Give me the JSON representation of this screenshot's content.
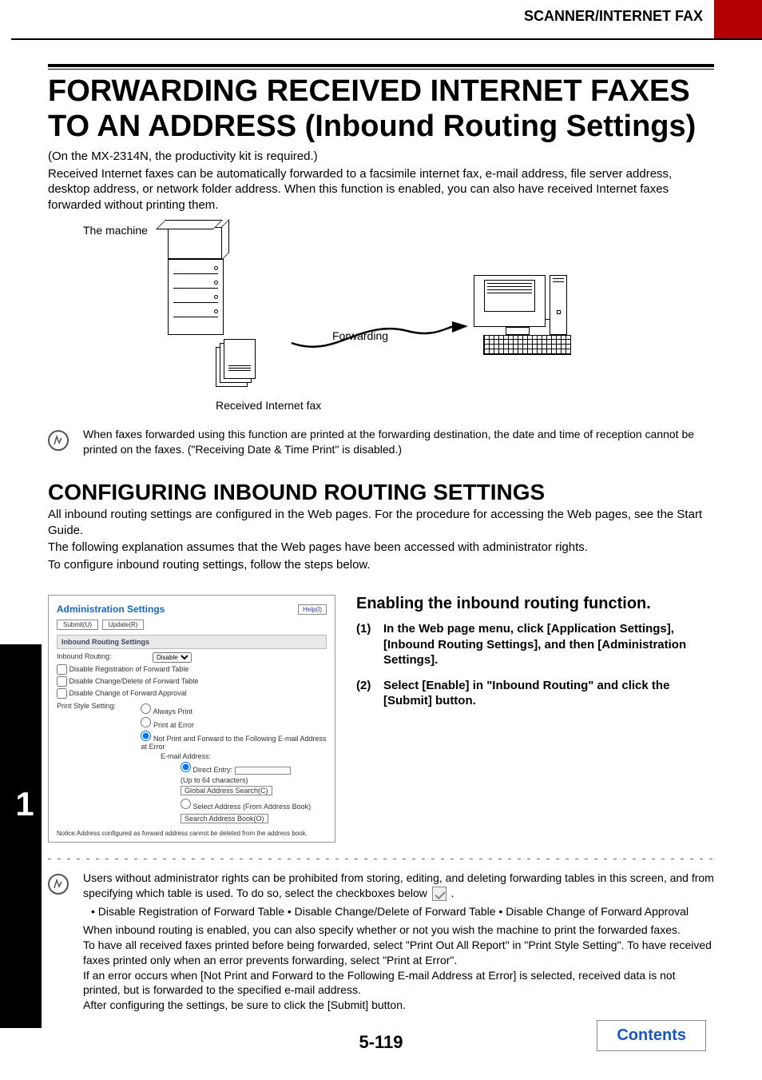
{
  "header": {
    "section": "SCANNER/INTERNET FAX"
  },
  "title": "FORWARDING RECEIVED INTERNET FAXES TO AN ADDRESS (Inbound Routing Settings)",
  "intro_note": "(On the MX-2314N, the productivity kit is required.)",
  "intro_body": "Received Internet faxes can be automatically forwarded to a facsimile internet fax, e-mail address, file server address, desktop address, or network folder address. When this function is enabled, you can also have received Internet faxes forwarded without printing them.",
  "diagram": {
    "machine_label": "The machine",
    "forwarding_label": "Forwarding",
    "received_label": "Received Internet fax"
  },
  "note1": "When faxes forwarded using this function are printed at the forwarding destination, the date and time of reception cannot be printed on the faxes. (\"Receiving Date & Time Print\" is disabled.)",
  "config_title": "CONFIGURING INBOUND ROUTING SETTINGS",
  "config_body1": "All inbound routing settings are configured in the Web pages. For the procedure for accessing the Web pages, see the Start Guide.",
  "config_body2": "The following explanation assumes that the Web pages have been accessed with administrator rights.",
  "config_body3": "To configure inbound routing settings, follow the steps below.",
  "step_num": "1",
  "panel": {
    "title": "Administration Settings",
    "help": "Help(I)",
    "submit": "Submit(U)",
    "update": "Update(R)",
    "section": "Inbound Routing Settings",
    "routing_label": "Inbound Routing:",
    "routing_value": "Disable",
    "cb1": "Disable Registration of Forward Table",
    "cb2": "Disable Change/Delete of Forward Table",
    "cb3": "Disable Change of Forward Approval",
    "pss_label": "Print Style Setting:",
    "r1": "Always Print",
    "r2": "Print at Error",
    "r3": "Not Print and Forward to the Following E-mail Address at Error",
    "email_label": "E-mail Address:",
    "de": "Direct Entry:",
    "upto": "(Up to 64 characters)",
    "gas": "Global Address Search(C)",
    "sab": "Select Address (From Address Book)",
    "search": "Search Address Book(O)",
    "notice": "Notice:Address configured as forward address cannot be deleted from the address book."
  },
  "instructions": {
    "heading": "Enabling the inbound routing function.",
    "items": [
      {
        "num": "(1)",
        "text": "In the Web page menu, click [Application Settings], [Inbound Routing Settings], and then [Administration Settings]."
      },
      {
        "num": "(2)",
        "text": "Select [Enable] in \"Inbound Routing\" and click the [Submit] button."
      }
    ]
  },
  "tips": {
    "l1_a": "Users without administrator rights can be prohibited from storing, editing, and deleting forwarding tables in this screen, and from specifying which table is used. To do so, select the checkboxes below ",
    "l1_b": " .",
    "bullets": "• Disable Registration of Forward Table   • Disable Change/Delete of Forward Table   • Disable Change of Forward Approval",
    "l2": "When inbound routing is enabled, you can also specify whether or not you wish the machine to print the forwarded faxes.",
    "l3": "To have all received faxes printed before being forwarded, select \"Print Out All Report\" in \"Print Style Setting\". To have received faxes printed only when an error prevents forwarding, select \"Print at Error\".",
    "l4": "If an error occurs when [Not Print and Forward to the Following E-mail Address at Error] is selected, received data is not printed, but is forwarded to the specified e-mail address.",
    "l5": "After configuring the settings, be sure to click the [Submit] button."
  },
  "page_num": "5-119",
  "contents": "Contents"
}
